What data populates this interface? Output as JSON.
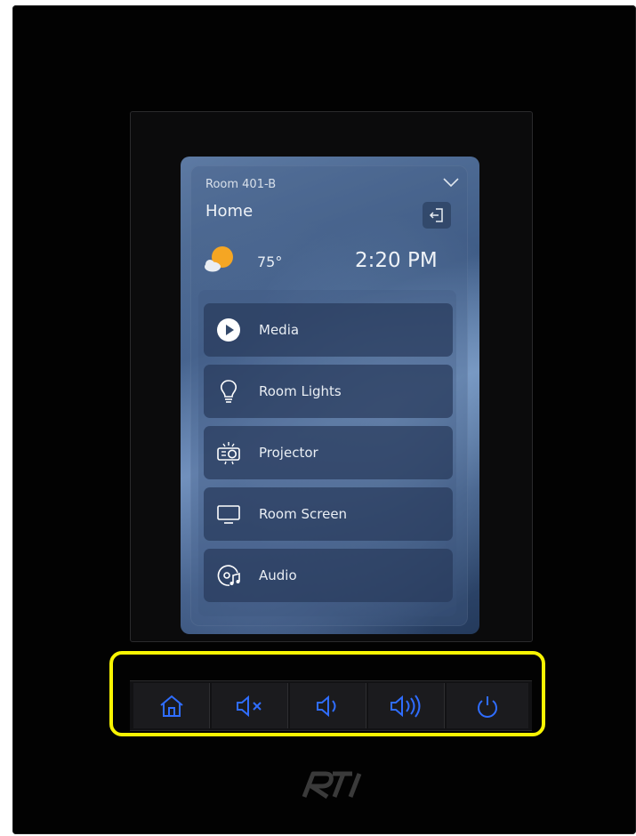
{
  "header": {
    "room_name": "Room 401-B",
    "page_title": "Home"
  },
  "status": {
    "temperature": "75°",
    "time": "2:20 PM",
    "weather_icon": "partly-sunny-icon"
  },
  "menu": {
    "items": [
      {
        "label": "Media",
        "icon": "play-icon"
      },
      {
        "label": "Room Lights",
        "icon": "lightbulb-icon"
      },
      {
        "label": "Projector",
        "icon": "projector-icon"
      },
      {
        "label": "Room Screen",
        "icon": "monitor-icon"
      },
      {
        "label": "Audio",
        "icon": "audio-disc-icon"
      }
    ]
  },
  "hardware_buttons": [
    {
      "name": "home",
      "icon": "home-icon"
    },
    {
      "name": "mute",
      "icon": "mute-icon"
    },
    {
      "name": "volume-down",
      "icon": "volume-low-icon"
    },
    {
      "name": "volume-up",
      "icon": "volume-high-icon"
    },
    {
      "name": "power",
      "icon": "power-icon"
    }
  ],
  "colors": {
    "button_icon": "#2f6dff",
    "highlight": "#f8f402",
    "text": "#eef2f7"
  },
  "brand": {
    "logo_text": "RTI"
  }
}
